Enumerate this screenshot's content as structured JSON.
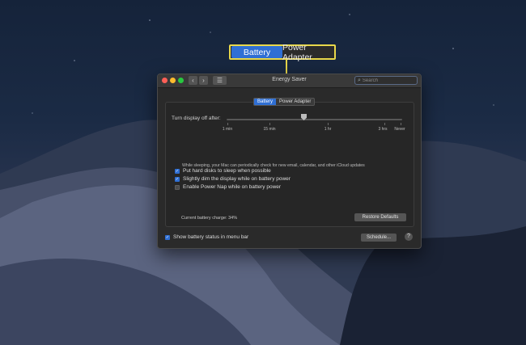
{
  "callout": {
    "tabs": [
      {
        "label": "Battery",
        "active": true
      },
      {
        "label": "Power Adapter",
        "active": false
      }
    ]
  },
  "window": {
    "title": "Energy Saver",
    "search_placeholder": "Search",
    "tabs": [
      {
        "label": "Battery",
        "active": true
      },
      {
        "label": "Power Adapter",
        "active": false
      }
    ],
    "display_off": {
      "label": "Turn display off after:",
      "ticks": [
        "1 min",
        "15 min",
        "1 hr",
        "3 hrs",
        "Never"
      ],
      "value_label": "15 min"
    },
    "options": [
      {
        "label": "Put hard disks to sleep when possible",
        "checked": true
      },
      {
        "label": "Slightly dim the display while on battery power",
        "checked": true
      },
      {
        "label": "Enable Power Nap while on battery power",
        "checked": false,
        "note": "While sleeping, your Mac can periodically check for new email, calendar, and other iCloud updates"
      }
    ],
    "battery_charge": "Current battery charge: 34%",
    "restore_label": "Restore Defaults",
    "menu_bar_option": {
      "label": "Show battery status in menu bar",
      "checked": true
    },
    "schedule_label": "Schedule...",
    "help_label": "?"
  },
  "colors": {
    "accent": "#2f6fd4",
    "highlight": "#e9d84a"
  }
}
